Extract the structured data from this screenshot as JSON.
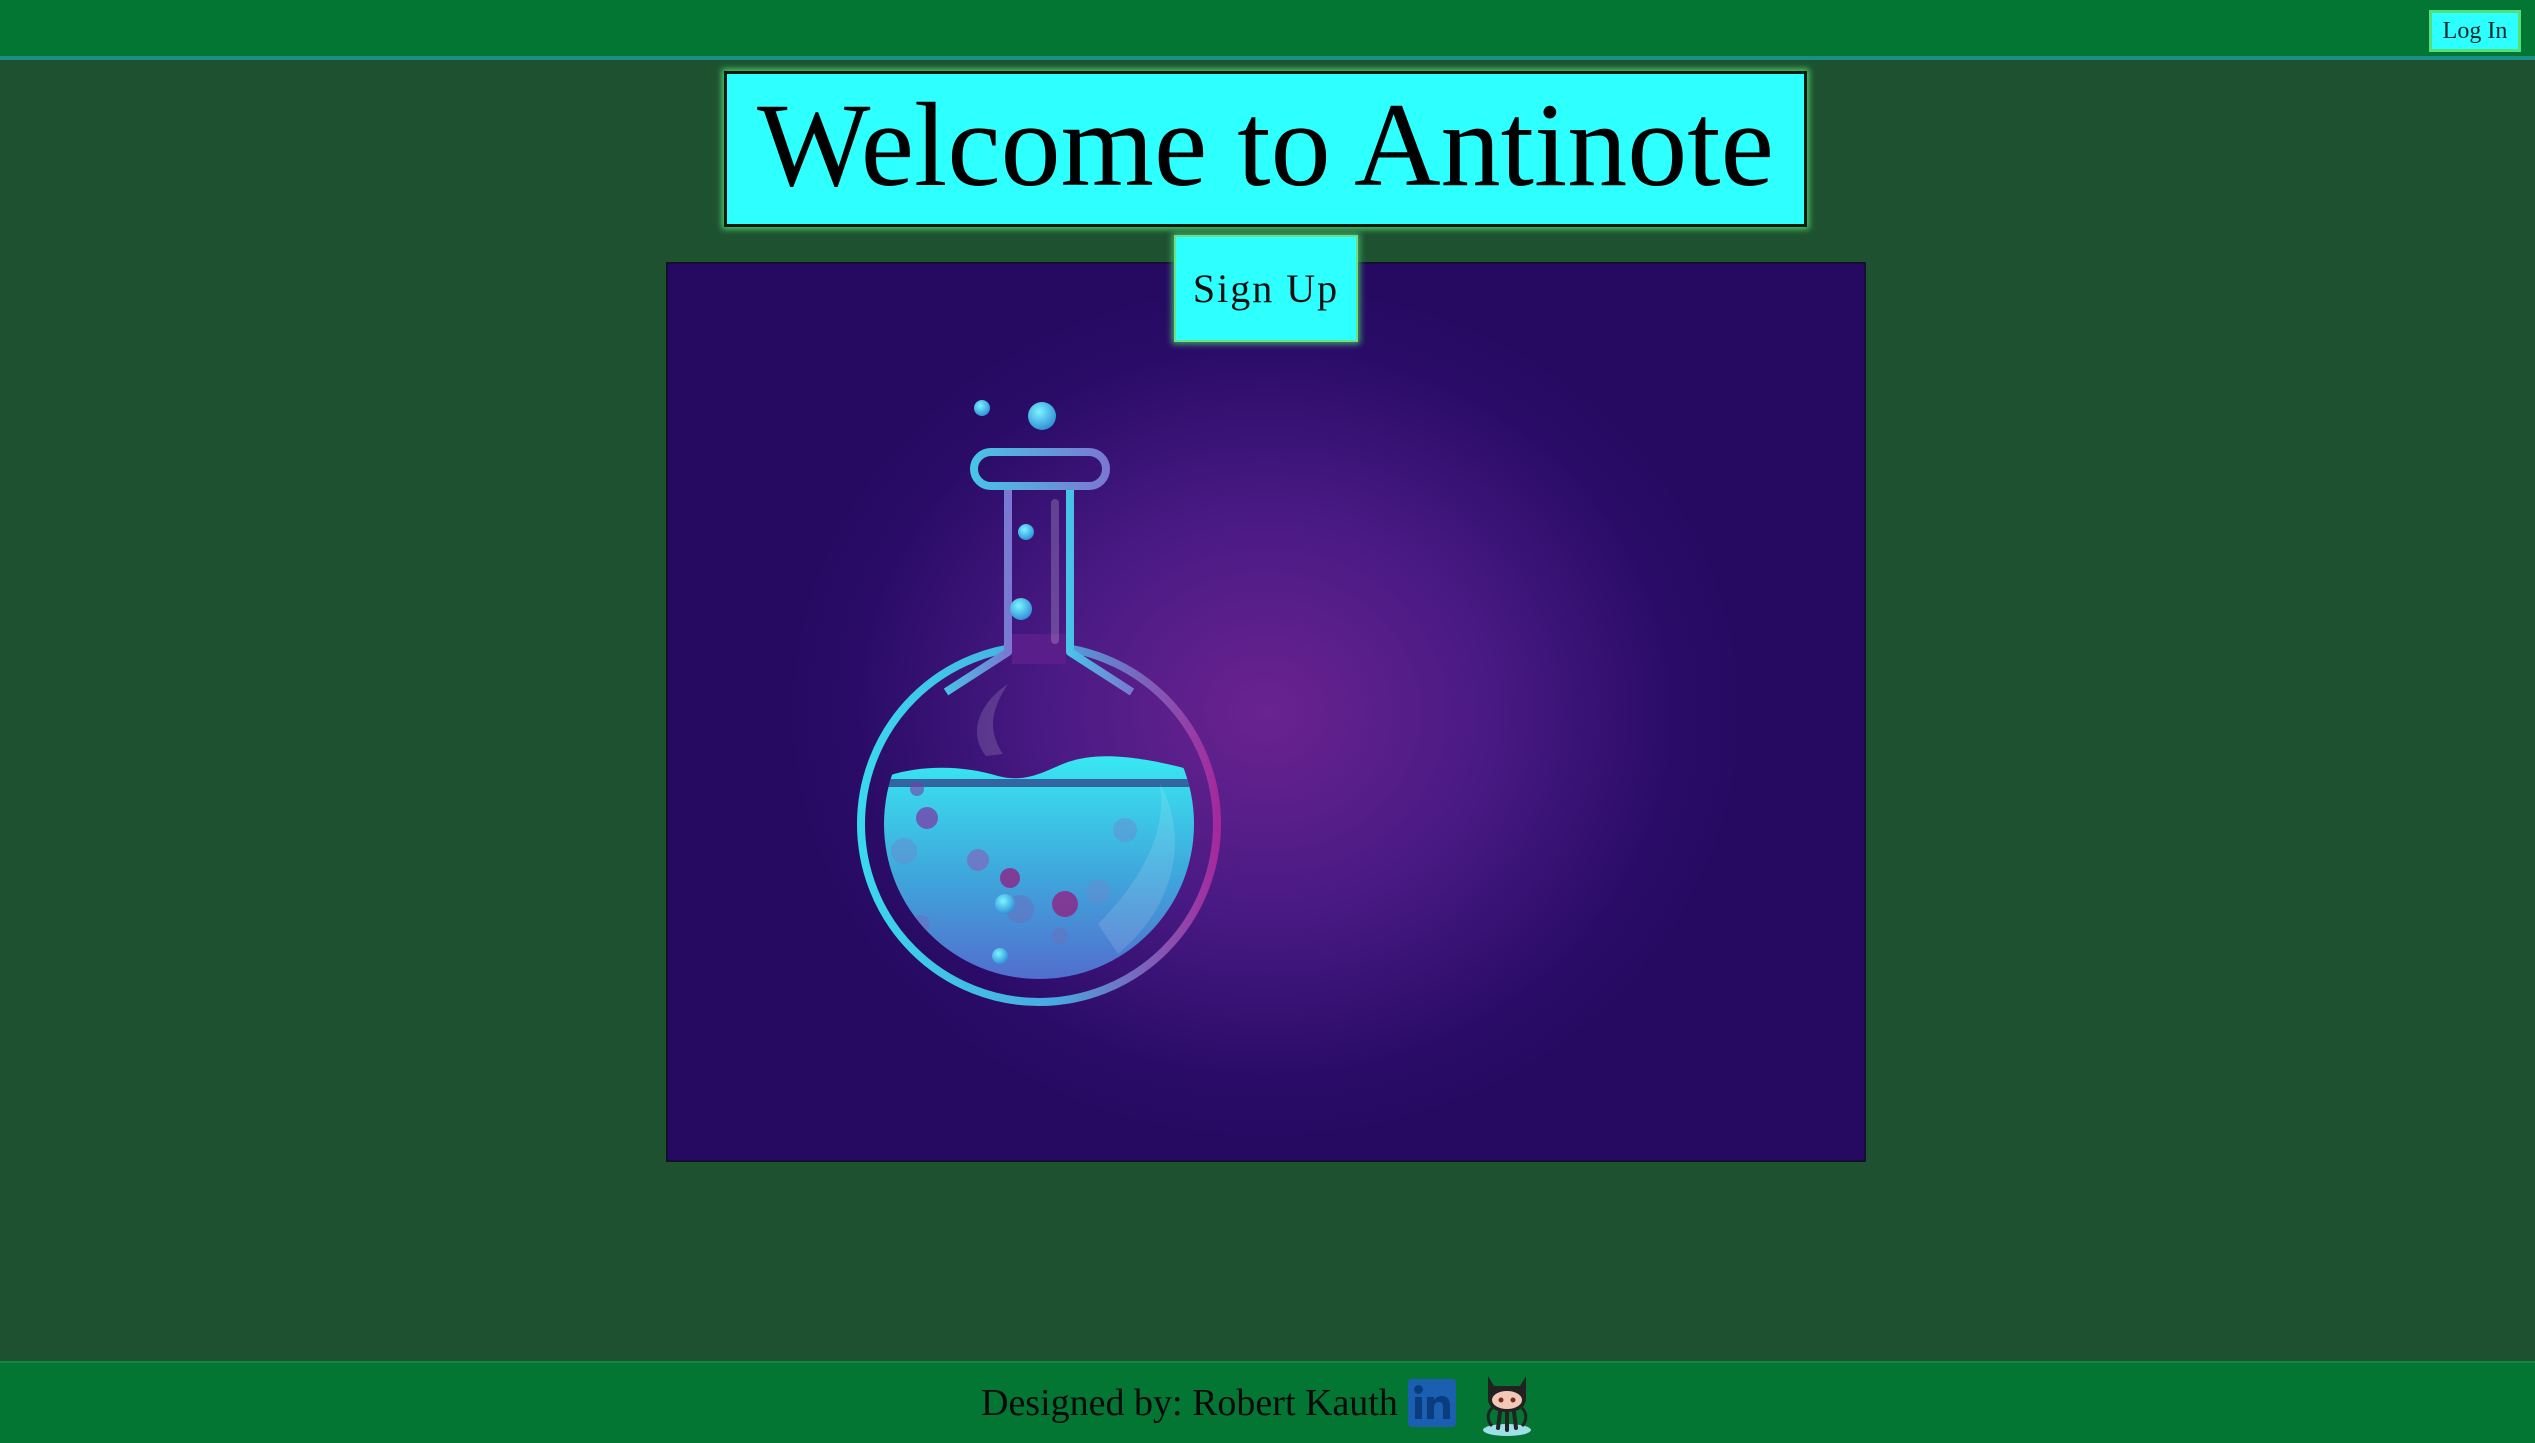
{
  "header": {
    "login_label": "Log In"
  },
  "main": {
    "title": "Welcome to Antinote",
    "signup_label": "Sign Up",
    "hero_image": "flask-illustration"
  },
  "footer": {
    "credit": "Designed by: Robert Kauth",
    "links": [
      {
        "icon": "linkedin-icon"
      },
      {
        "icon": "github-octocat-icon"
      }
    ]
  },
  "colors": {
    "background": "#1e5130",
    "bar": "#037634",
    "accent": "#2effff",
    "hero_bg": "#2a0c68"
  }
}
